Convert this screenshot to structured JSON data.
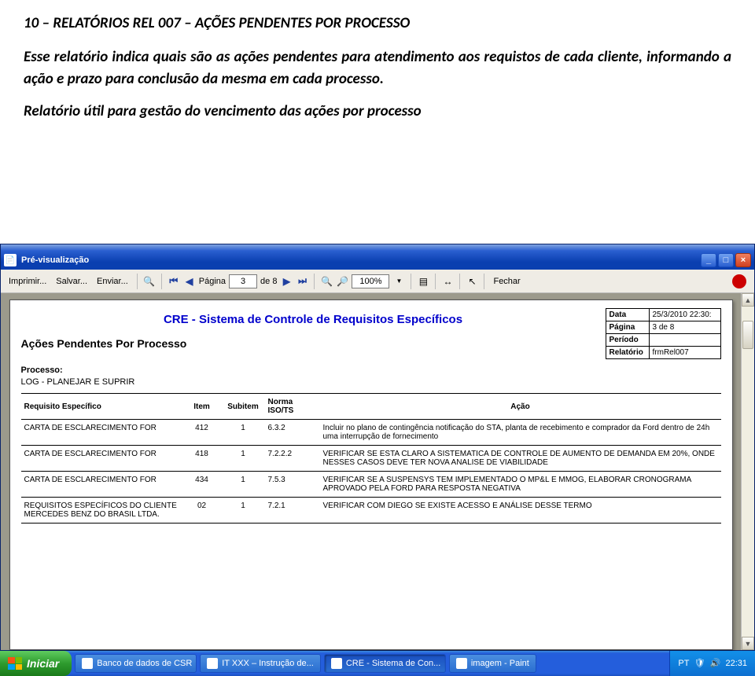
{
  "doc": {
    "title": "10 – RELATÓRIOS REL 007 – AÇÕES PENDENTES POR PROCESSO",
    "p1": "Esse relatório indica quais são as ações pendentes para atendimento aos requistos de cada cliente, informando a ação e prazo para conclusão da mesma em cada processo.",
    "p2": "Relatório útil para gestão do vencimento das ações por processo"
  },
  "window": {
    "title": "Pré-visualização"
  },
  "toolbar": {
    "print": "Imprimir...",
    "save": "Salvar...",
    "send": "Enviar...",
    "page_label_pre": "Página",
    "page_value": "3",
    "page_label_post": "de 8",
    "zoom_value": "100%",
    "close": "Fechar"
  },
  "report": {
    "main_title": "CRE - Sistema de Controle de Requisitos Específicos",
    "sub_title": "Ações Pendentes Por Processo",
    "meta": [
      {
        "k": "Data",
        "v": "25/3/2010 22:30:"
      },
      {
        "k": "Página",
        "v": "3 de 8"
      },
      {
        "k": "Período",
        "v": ""
      },
      {
        "k": "Relatório",
        "v": "frmRel007"
      }
    ],
    "proc_label": "Processo:",
    "proc_value": "LOG - PLANEJAR E SUPRIR",
    "columns": [
      "Requisito Específico",
      "Item",
      "Subitem",
      "Norma ISO/TS",
      "Ação"
    ],
    "rows": [
      {
        "c1": "CARTA DE ESCLARECIMENTO FOR",
        "c2": "412",
        "c3": "1",
        "c4": "6.3.2",
        "c5": "Incluir no plano de contingência notificação do STA, planta de recebimento e comprador da Ford dentro de 24h uma interrupção de fornecimento"
      },
      {
        "c1": "CARTA DE ESCLARECIMENTO FOR",
        "c2": "418",
        "c3": "1",
        "c4": "7.2.2.2",
        "c5": "VERIFICAR SE ESTA CLARO A SISTEMATICA DE CONTROLE DE AUMENTO DE DEMANDA EM 20%, ONDE NESSES CASOS DEVE TER NOVA ANALISE DE VIABILIDADE"
      },
      {
        "c1": "CARTA DE ESCLARECIMENTO FOR",
        "c2": "434",
        "c3": "1",
        "c4": "7.5.3",
        "c5": "VERIFICAR SE A SUSPENSYS TEM IMPLEMENTADO O MP&L E MMOG, ELABORAR CRONOGRAMA APROVADO PELA FORD PARA RESPOSTA NEGATIVA"
      },
      {
        "c1": "REQUISITOS ESPECÍFICOS DO CLIENTE MERCEDES BENZ DO BRASIL LTDA.",
        "c2": "02",
        "c3": "1",
        "c4": "7.2.1",
        "c5": "VERIFICAR COM DIEGO SE EXISTE ACESSO E ANÁLISE DESSE TERMO"
      }
    ]
  },
  "taskbar": {
    "start": "Iniciar",
    "tasks": [
      "Banco de dados de CSR",
      "IT XXX – Instrução de...",
      "CRE - Sistema de Con...",
      "imagem - Paint"
    ],
    "lang": "PT",
    "clock": "22:31"
  }
}
